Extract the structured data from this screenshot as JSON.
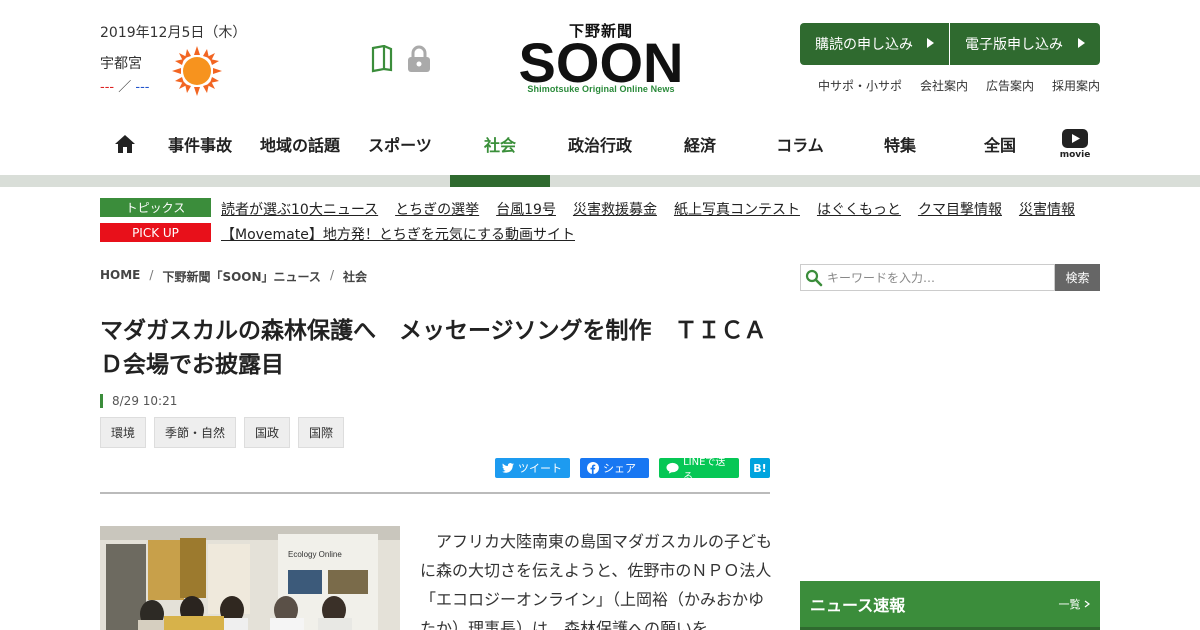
{
  "header": {
    "date": "2019年12月5日（木）",
    "city": "宇都宮",
    "temp_high": "---",
    "temp_sep": "／",
    "temp_low": "---",
    "logo_jp": "下野新聞",
    "logo_en": "SOON",
    "logo_tagline": "Shimotsuke Original Online News",
    "subscribe_label": "購読の申し込み",
    "digital_label": "電子版申し込み",
    "top_links": [
      "中サポ・小サポ",
      "会社案内",
      "広告案内",
      "採用案内"
    ],
    "icons": {
      "weather": "sun-icon",
      "book": "book-icon",
      "lock": "lock-icon"
    },
    "colors": {
      "brand_green": "#2f6a2f",
      "accent_green": "#3b8d3b",
      "pickup_red": "#e8101a"
    }
  },
  "nav": {
    "items": [
      "事件事故",
      "地域の話題",
      "スポーツ",
      "社会",
      "政治行政",
      "経済",
      "コラム",
      "特集",
      "全国"
    ],
    "active": "社会",
    "movie_label": "movie"
  },
  "topics": {
    "label": "トピックス",
    "links": [
      "読者が選ぶ10大ニュース",
      "とちぎの選挙",
      "台風19号",
      "災害救援募金",
      "紙上写真コンテスト",
      "はぐくもっと",
      "クマ目撃情報",
      "災害情報"
    ],
    "pickup_label": "PICK UP",
    "pickup_link": "【Movemate】地方発！とちぎを元気にする動画サイト"
  },
  "breadcrumb": [
    "HOME",
    "下野新聞「SOON」ニュース",
    "社会"
  ],
  "breadcrumb_sep": "/",
  "search": {
    "placeholder": "キーワードを入力…",
    "button": "検索"
  },
  "article": {
    "title": "マダガスカルの森林保護へ　メッセージソングを制作　ＴＩＣＡＤ会場でお披露目",
    "time": "8/29 10:21",
    "categories": [
      "環境",
      "季節・自然",
      "国政",
      "国際"
    ],
    "share": {
      "twitter": "ツイート",
      "facebook": "シェア",
      "line": "LINEで送る",
      "hatena": "B!"
    },
    "photo_sign": "Ecology Online",
    "body": "アフリカ大陸南東の島国マダガスカルの子どもに森の大切さを伝えようと、佐野市のＮＰＯ法人「エコロジーオンライン」（上岡裕（かみおかゆたか）理事長）は、森林保護への願いを"
  },
  "sidebar": {
    "news_title": "ニュース速報",
    "news_more": "一覧"
  }
}
